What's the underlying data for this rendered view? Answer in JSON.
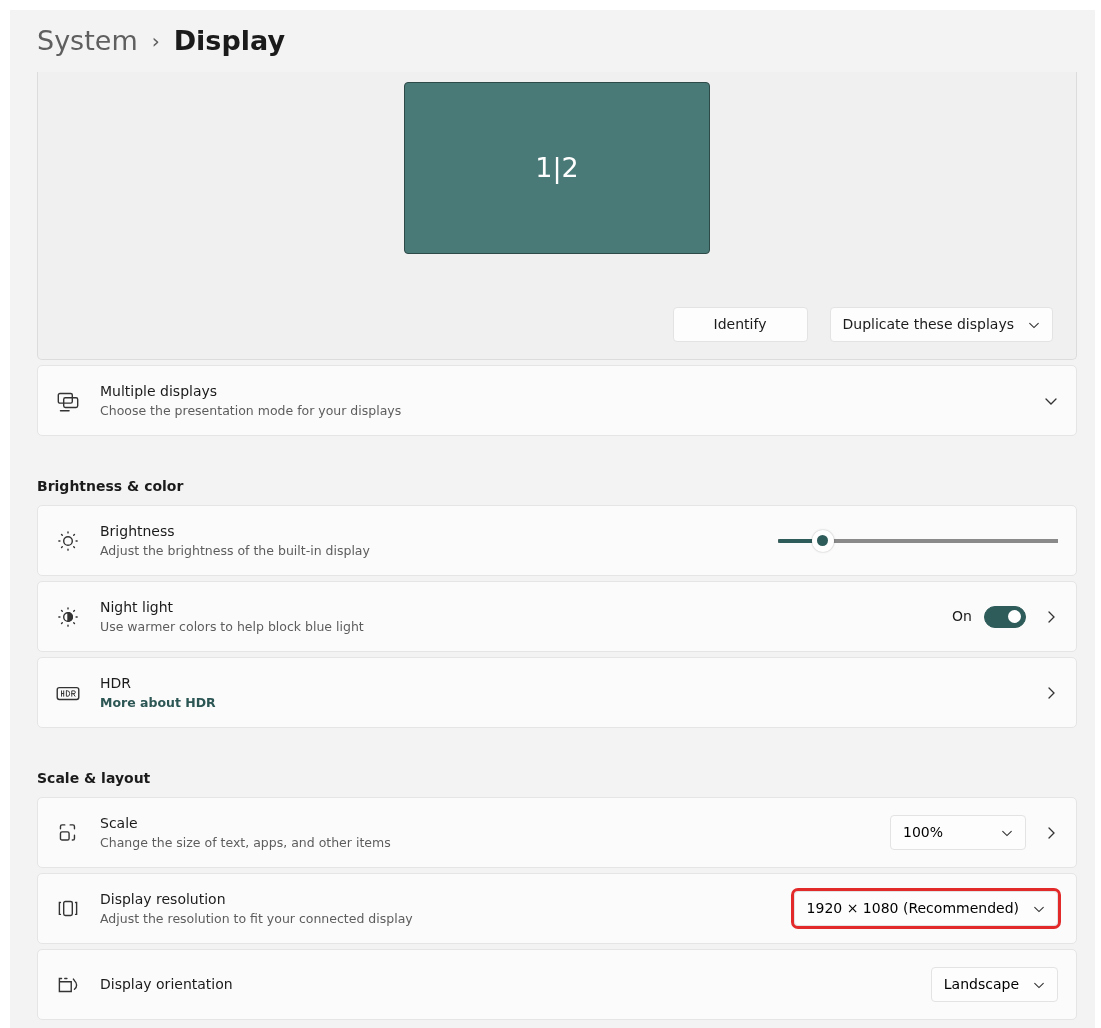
{
  "breadcrumb": {
    "parent": "System",
    "separator": "›",
    "current": "Display"
  },
  "arrangement": {
    "monitor_label": "1|2",
    "buttons": [
      {
        "kind": "button",
        "label": "Identify"
      },
      {
        "kind": "dropdown",
        "label": "Duplicate these displays"
      }
    ]
  },
  "sections": [
    {
      "rows": [
        {
          "title": "Multiple displays",
          "subtitle": "Choose the presentation mode for your displays",
          "expandable": true
        }
      ]
    },
    {
      "heading": "Brightness & color",
      "rows": [
        {
          "title": "Brightness",
          "subtitle": "Adjust the brightness of the built-in display",
          "control": {
            "kind": "slider",
            "level": 0.16
          }
        },
        {
          "title": "Night light",
          "subtitle": "Use warmer colors to help block blue light",
          "control": {
            "kind": "toggle",
            "label": "On",
            "on": true
          },
          "navigable": true
        },
        {
          "title": "HDR",
          "link": "More about HDR",
          "navigable": true
        }
      ]
    },
    {
      "heading": "Scale & layout",
      "rows": [
        {
          "title": "Scale",
          "subtitle": "Change the size of text, apps, and other items",
          "control": {
            "kind": "dropdown",
            "value": "100%",
            "highlighted": false
          },
          "navigable": true
        },
        {
          "title": "Display resolution",
          "subtitle": "Adjust the resolution to fit your connected display",
          "control": {
            "kind": "dropdown",
            "value": "1920 × 1080 (Recommended)",
            "highlighted": true
          }
        },
        {
          "title": "Display orientation",
          "control": {
            "kind": "dropdown",
            "value": "Landscape",
            "highlighted": false
          }
        }
      ]
    }
  ]
}
